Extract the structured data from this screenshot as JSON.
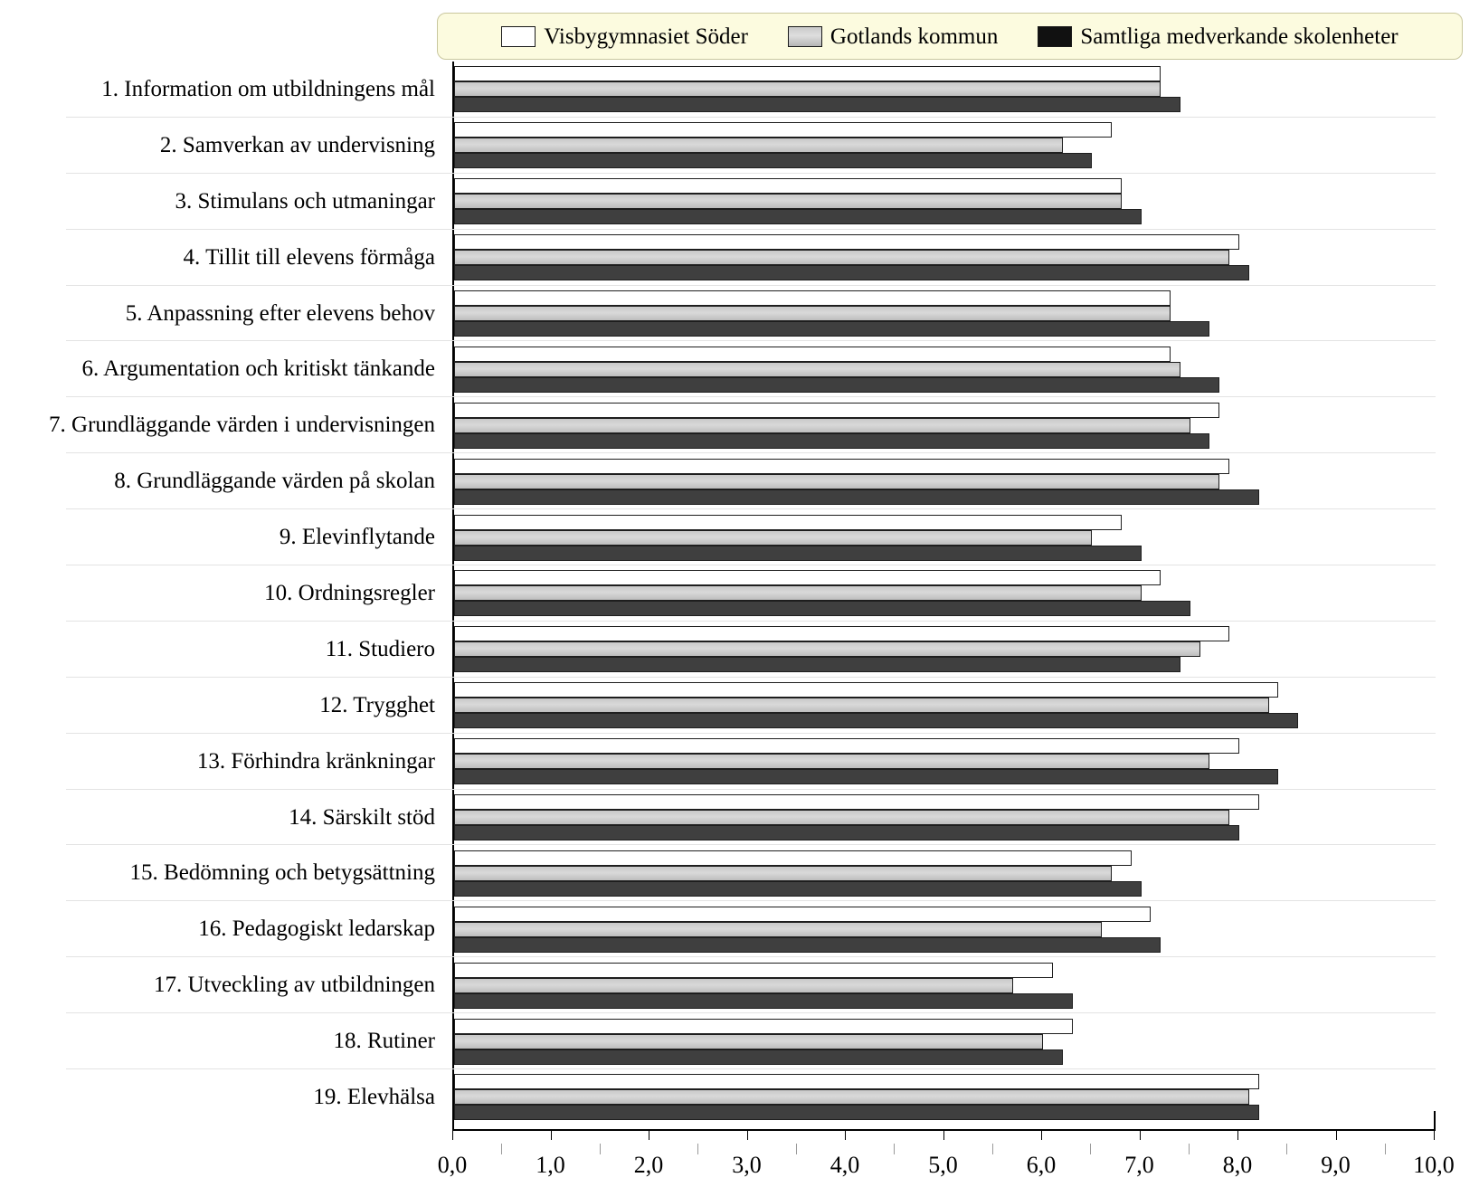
{
  "chart_data": {
    "type": "bar",
    "orientation": "horizontal",
    "title": "",
    "xlabel": "",
    "ylabel": "",
    "xlim": [
      0.0,
      10.0
    ],
    "xticks": [
      "0,0",
      "1,0",
      "2,0",
      "3,0",
      "4,0",
      "5,0",
      "6,0",
      "7,0",
      "8,0",
      "9,0",
      "10,0"
    ],
    "grid": false,
    "legend_position": "top",
    "legend_background": "#fcfbdf",
    "series_colors": [
      "#ffffff",
      "#d0d0d0",
      "#3f3f3f"
    ],
    "categories": [
      "1. Information om utbildningens mål",
      "2. Samverkan av undervisning",
      "3. Stimulans och utmaningar",
      "4. Tillit till elevens förmåga",
      "5. Anpassning efter elevens behov",
      "6. Argumentation och kritiskt tänkande",
      "7. Grundläggande värden i undervisningen",
      "8. Grundläggande värden på skolan",
      "9. Elevinflytande",
      "10. Ordningsregler",
      "11. Studiero",
      "12. Trygghet",
      "13. Förhindra kränkningar",
      "14. Särskilt stöd",
      "15. Bedömning och betygsättning",
      "16. Pedagogiskt ledarskap",
      "17. Utveckling av utbildningen",
      "18. Rutiner",
      "19. Elevhälsa"
    ],
    "series": [
      {
        "name": "Visbygymnasiet Söder",
        "values": [
          7.2,
          6.7,
          6.8,
          8.0,
          7.3,
          7.3,
          7.8,
          7.9,
          6.8,
          7.2,
          7.9,
          8.4,
          8.0,
          8.2,
          6.9,
          7.1,
          6.1,
          6.3,
          8.2
        ]
      },
      {
        "name": "Gotlands kommun",
        "values": [
          7.2,
          6.2,
          6.8,
          7.9,
          7.3,
          7.4,
          7.5,
          7.8,
          6.5,
          7.0,
          7.6,
          8.3,
          7.7,
          7.9,
          6.7,
          6.6,
          5.7,
          6.0,
          8.1
        ]
      },
      {
        "name": "Samtliga medverkande skolenheter",
        "values": [
          7.4,
          6.5,
          7.0,
          8.1,
          7.7,
          7.8,
          7.7,
          8.2,
          7.0,
          7.5,
          7.4,
          8.6,
          8.4,
          8.0,
          7.0,
          7.2,
          6.3,
          6.2,
          8.2
        ]
      }
    ]
  },
  "legend": {
    "entries": [
      {
        "label": "Visbygymnasiet Söder",
        "swatch": "#ffffff"
      },
      {
        "label": "Gotlands kommun",
        "swatch": "#d0d0d0"
      },
      {
        "label": "Samtliga medverkande skolenheter",
        "swatch": "#111111"
      }
    ]
  }
}
